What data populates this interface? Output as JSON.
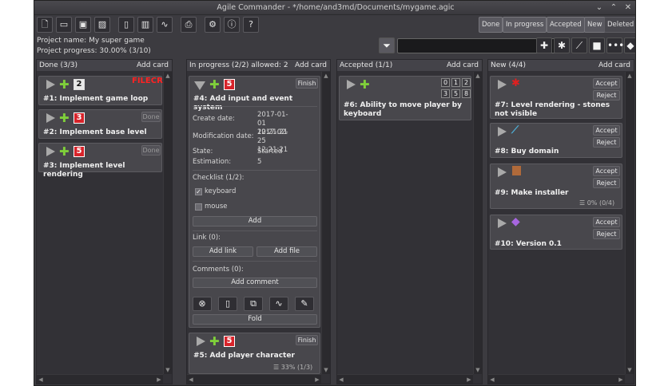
{
  "window": {
    "title": "Agile Commander - */home/and3md/Documents/mygame.agic"
  },
  "filters": {
    "done": "Done",
    "in_progress": "In progress",
    "accepted": "Accepted",
    "new": "New",
    "deleted": "Deleted"
  },
  "project": {
    "name": "Project name: My super game",
    "progress": "Project progress: 30.00% (3/10)"
  },
  "columns": {
    "done": {
      "title": "Done (3/3)",
      "add": "Add card"
    },
    "in_progress": {
      "title": "In progress (2/2) allowed: 2",
      "add": "Add card"
    },
    "accepted": {
      "title": "Accepted (1/1)",
      "add": "Add card"
    },
    "new": {
      "title": "New (4/4)",
      "add": "Add card"
    }
  },
  "cards": {
    "c1": {
      "title": "#1: Implement game loop",
      "num": "2"
    },
    "c2": {
      "title": "#2: Implement base level",
      "num": "3",
      "btn": "Done"
    },
    "c3": {
      "title": "#3: Implement level rendering",
      "num": "5",
      "btn": "Done"
    },
    "c4": {
      "title": "#4: Add input and event system",
      "num": "5",
      "btn": "Finish",
      "create_label": "Create date:",
      "create_value": "2017-01-01 12:21:21",
      "mod_label": "Modification date:",
      "mod_value": "2017-02-25 12:21:21",
      "state_label": "State:",
      "state_value": "Started",
      "est_label": "Estimation:",
      "est_value": "5",
      "checklist": "Checklist (1/2):",
      "item1": "keyboard",
      "item2": "mouse",
      "add": "Add",
      "link": "Link (0):",
      "add_link": "Add link",
      "add_file": "Add file",
      "comments": "Comments (0):",
      "add_comment": "Add comment",
      "fold": "Fold"
    },
    "c5": {
      "title": "#5: Add player character",
      "num": "5",
      "btn": "Finish",
      "progress": "33% (1/3)"
    },
    "c6": {
      "title": "#6: Ability to move player by keyboard",
      "grid": [
        "0",
        "1",
        "2",
        "3",
        "5",
        "8"
      ]
    },
    "c7": {
      "title": "#7: Level rendering - stones not visible",
      "accept": "Accept",
      "reject": "Reject"
    },
    "c8": {
      "title": "#8: Buy domain",
      "accept": "Accept",
      "reject": "Reject"
    },
    "c9": {
      "title": "#9: Make installer",
      "accept": "Accept",
      "reject": "Reject",
      "progress": "0% (0/4)"
    },
    "c10": {
      "title": "#10: Version 0.1",
      "accept": "Accept",
      "reject": "Reject"
    }
  },
  "watermark": "FILECR",
  "colors": {
    "bg": "#3c3b40",
    "badge_red": "#d8232a",
    "plus_green": "#7fcf3a"
  }
}
